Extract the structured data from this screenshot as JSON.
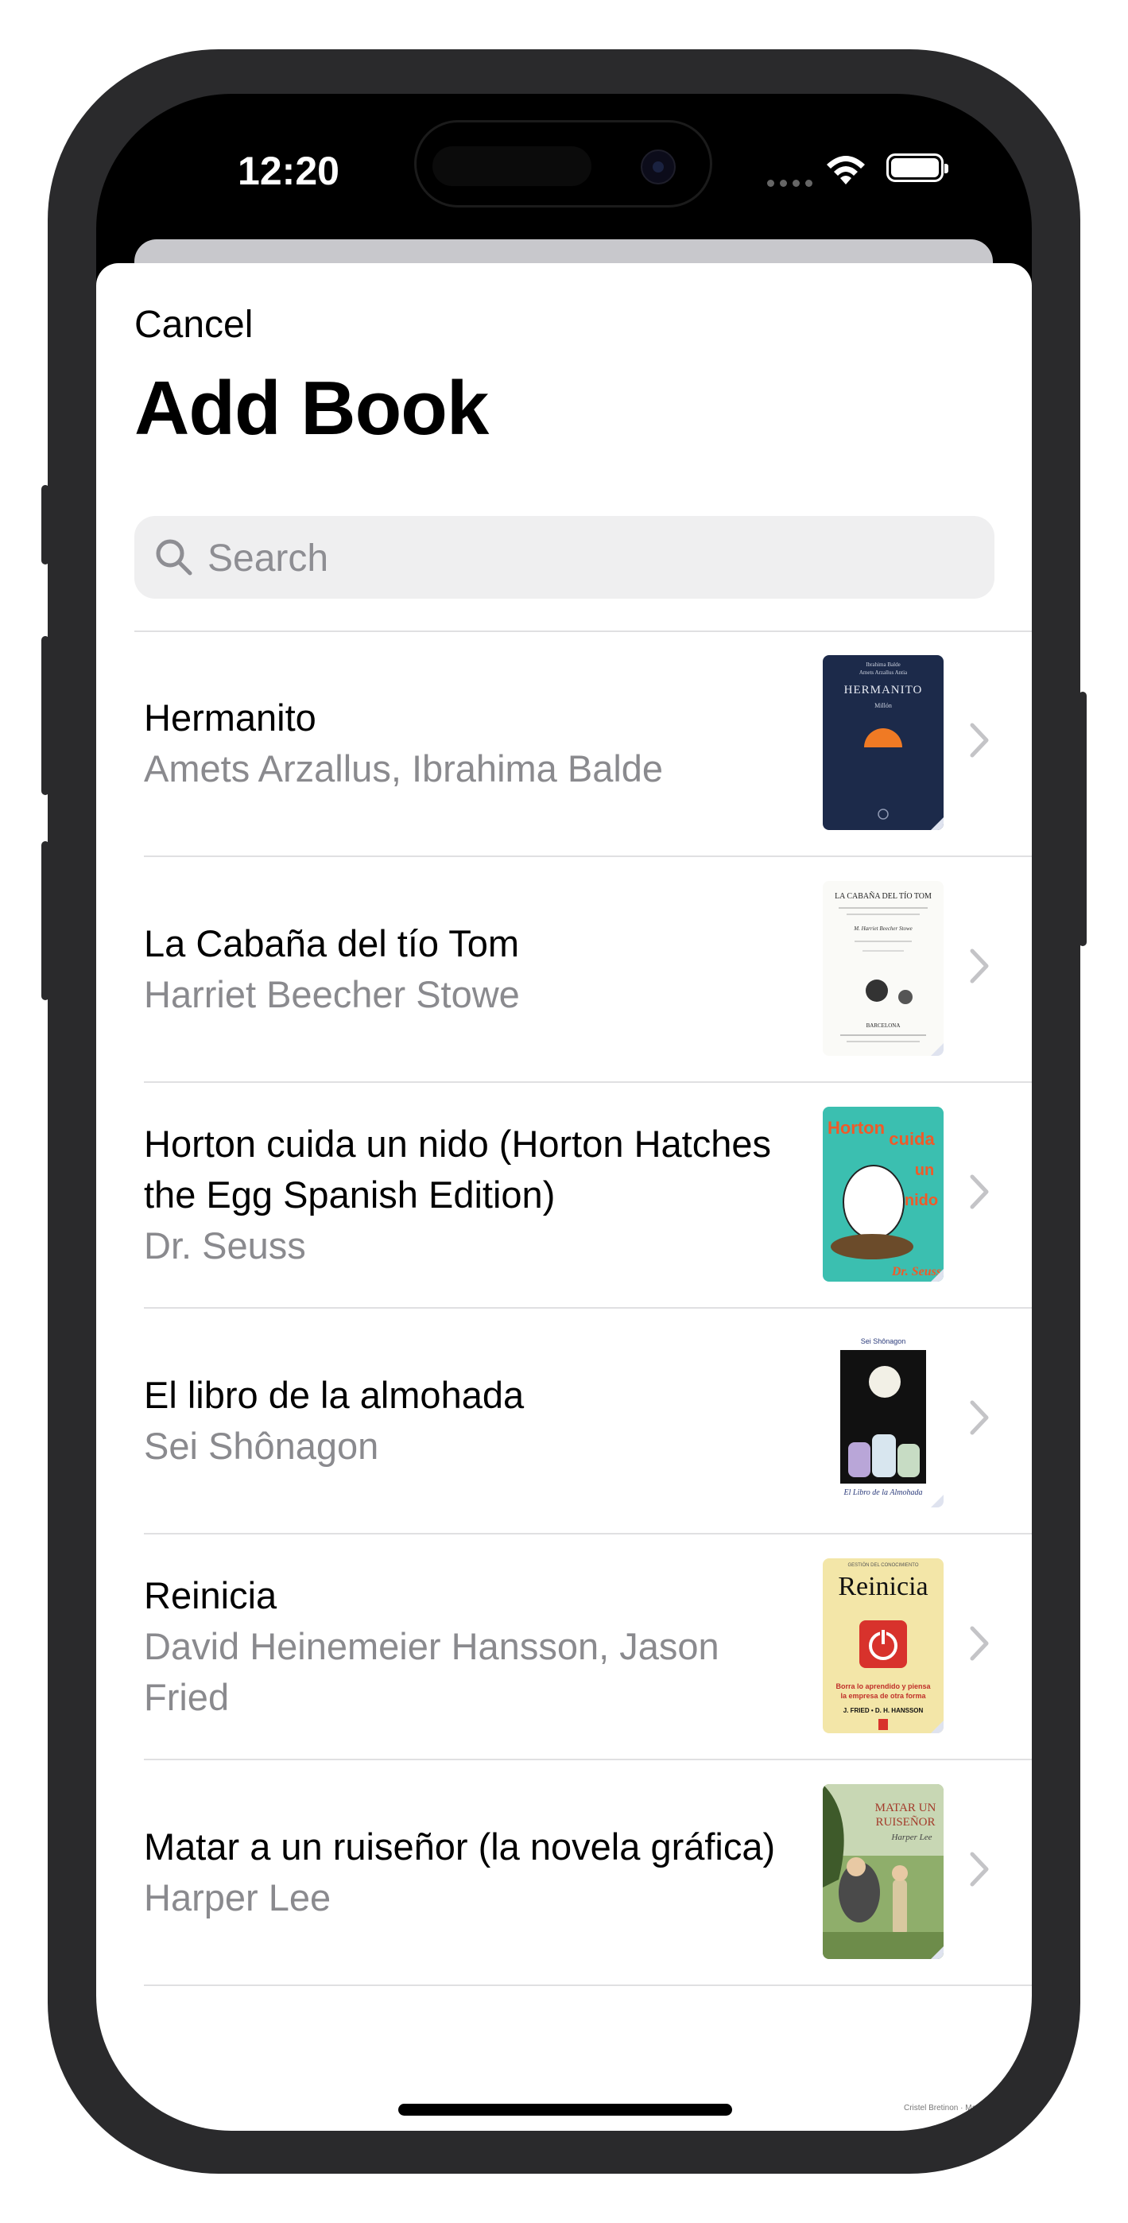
{
  "status_bar": {
    "time": "12:20"
  },
  "sheet": {
    "cancel_label": "Cancel",
    "title": "Add Book",
    "search": {
      "placeholder": "Search"
    }
  },
  "books": [
    {
      "title": "Hermanito",
      "authors": "Amets Arzallus, Ibrahima Balde",
      "cover_icon": "hermanito-cover"
    },
    {
      "title": "La Cabaña del tío Tom",
      "authors": "Harriet Beecher Stowe",
      "cover_icon": "cabana-cover"
    },
    {
      "title": "Horton cuida un nido (Horton Hatches the Egg Spanish Edition)",
      "authors": "Dr. Seuss",
      "cover_icon": "horton-cover"
    },
    {
      "title": "El libro de la almohada",
      "authors": "Sei Shônagon",
      "cover_icon": "almohada-cover"
    },
    {
      "title": "Reinicia",
      "authors": "David Heinemeier Hansson, Jason Fried",
      "cover_icon": "reinicia-cover"
    },
    {
      "title": "Matar a un ruiseñor (la novela gráfica)",
      "authors": "Harper Lee",
      "cover_icon": "ruisenor-cover"
    }
  ],
  "covers": {
    "hermanito": {
      "authors_line1": "Ibrahima Balde",
      "authors_line2": "Amets Arzallus Antia",
      "title": "HERMANITO",
      "sub": "Millón"
    },
    "cabana": {
      "title": "LA CABAÑA DEL TÍO TOM",
      "author": "M. Harriet Beecher Stowe",
      "city": "BARCELONA"
    },
    "horton": {
      "w1": "Horton",
      "w2": "cuida",
      "w3": "un",
      "w4": "nido",
      "brand": "Dr. Seuss"
    },
    "almohada": {
      "author": "Sei Shônagon",
      "title": "El Libro de la Almohada"
    },
    "reinicia": {
      "top": "GESTIÓN DEL CONOCIMIENTO",
      "title": "Reinicia",
      "sub1": "Borra lo aprendido y piensa",
      "sub2": "la empresa de otra forma",
      "authors": "J. FRIED • D. H. HANSSON"
    },
    "ruisenor": {
      "title1": "MATAR UN",
      "title2": "RUISEÑOR",
      "author": "Harper Lee"
    },
    "partial": {
      "text": "Cristel Bretinon · Maite Bramenuel"
    }
  },
  "colors": {
    "accent": "#000000",
    "secondary_text": "#8a8a8e",
    "separator": "#e0e0e2",
    "search_bg": "#efeff0"
  }
}
